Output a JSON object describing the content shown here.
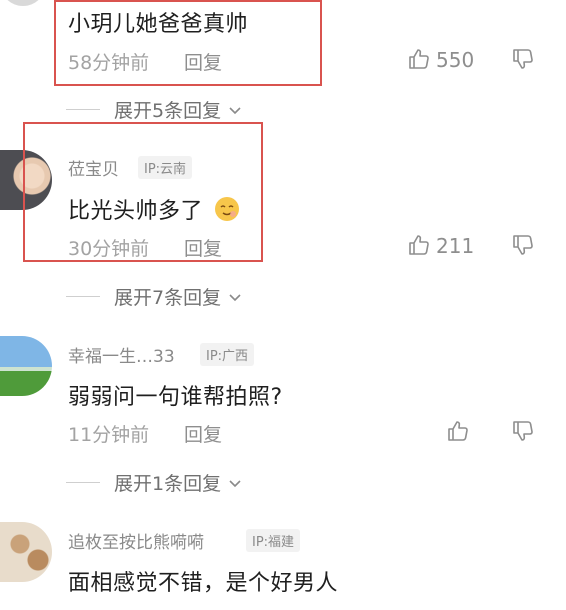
{
  "comments": [
    {
      "text": "小玥儿她爸爸真帅",
      "time": "58分钟前",
      "reply_label": "回复",
      "likes": "550"
    },
    {
      "username": "莅宝贝",
      "ip": "IP:云南",
      "text": "比光头帅多了",
      "time": "30分钟前",
      "reply_label": "回复",
      "likes": "211"
    },
    {
      "username": "幸福一生…33",
      "ip": "IP:广西",
      "text": "弱弱问一句谁帮拍照?",
      "time": "11分钟前",
      "reply_label": "回复",
      "likes": ""
    },
    {
      "username": "追枚至按比熊嗬嗬",
      "ip": "IP:福建",
      "text": "面相感觉不错，是个好男人"
    }
  ],
  "expand_labels": [
    "展开5条回复",
    "展开7条回复",
    "展开1条回复"
  ],
  "icons": {
    "like": "thumbs-up-icon",
    "dislike": "thumbs-down-icon",
    "chevron": "chevron-down-icon"
  },
  "colors": {
    "highlight": "#d9534f",
    "text": "#1f1f1f",
    "muted": "#a3a3a3"
  }
}
